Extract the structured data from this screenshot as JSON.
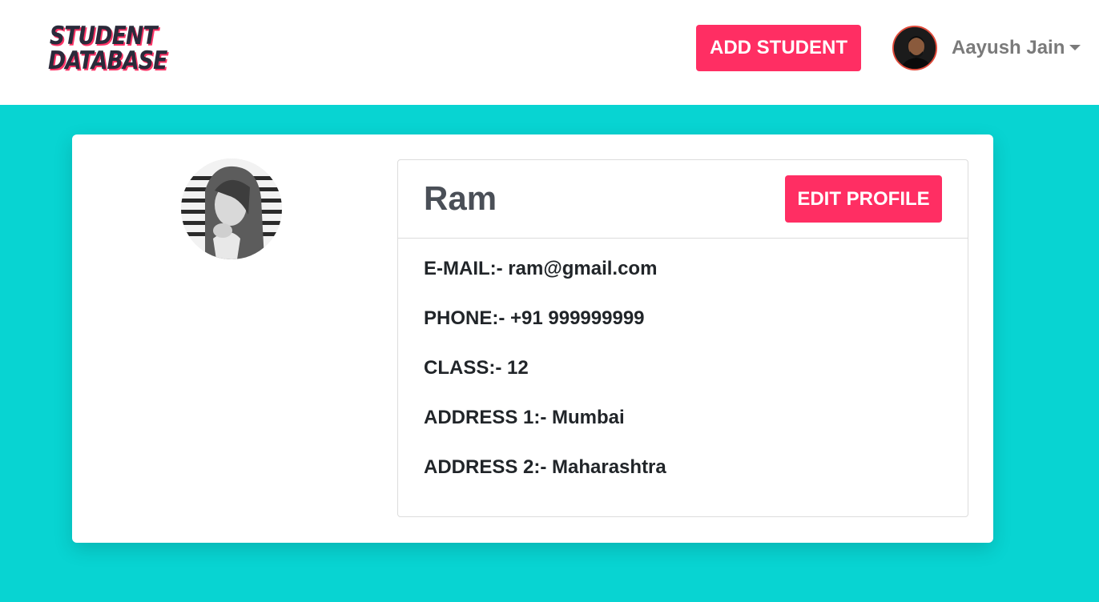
{
  "navbar": {
    "logo_line1": "STUDENT",
    "logo_line2": "DATABASE",
    "add_student_label": "ADD STUDENT",
    "user_name": "Aayush Jain"
  },
  "profile": {
    "name": "Ram",
    "edit_label": "EDIT PROFILE",
    "details": [
      "E-MAIL:- ram@gmail.com",
      "PHONE:- +91 999999999",
      "CLASS:- 12",
      "ADDRESS 1:- Mumbai",
      "ADDRESS 2:- Maharashtra"
    ]
  },
  "colors": {
    "accent": "#ff2e63",
    "background": "#08d4d2",
    "nav_background": "#ffffff"
  },
  "icons": {
    "user_avatar": "avatar-icon",
    "dropdown": "chevron-down-icon",
    "profile_photo": "profile-photo"
  }
}
